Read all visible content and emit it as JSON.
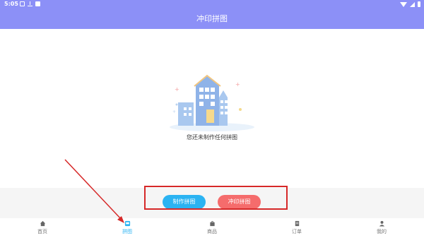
{
  "status_bar": {
    "time": "5:05",
    "left_icons": [
      "photo-icon",
      "download-icon",
      "close-icon"
    ],
    "right_icons": [
      "wifi-icon",
      "signal-icon",
      "battery-icon"
    ]
  },
  "header": {
    "title": "冲印拼图"
  },
  "empty_state": {
    "message": "您还未制作任何拼图"
  },
  "actions": {
    "make_label": "制作拼图",
    "print_label": "冲印拼图"
  },
  "tabs": [
    {
      "label": "首页",
      "icon": "home-icon"
    },
    {
      "label": "拼图",
      "icon": "collage-icon",
      "active": true
    },
    {
      "label": "商品",
      "icon": "shopping-bag-icon"
    },
    {
      "label": "订单",
      "icon": "order-icon"
    },
    {
      "label": "我的",
      "icon": "person-icon"
    }
  ],
  "colors": {
    "header": "#8c90f7",
    "make_button": "#2bb3f2",
    "print_button": "#f56c6c",
    "active_tab": "#2bb3f2",
    "annotation": "#d62828"
  }
}
